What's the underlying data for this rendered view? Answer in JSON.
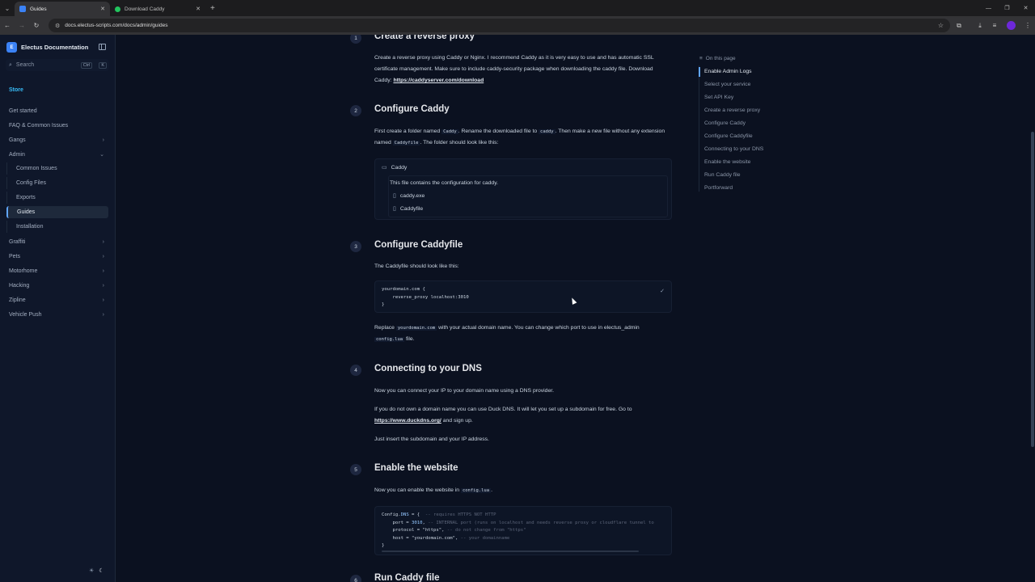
{
  "browser": {
    "tabs": [
      {
        "title": "Guides",
        "active": true
      },
      {
        "title": "Download Caddy",
        "active": false
      }
    ],
    "url": "docs.electus-scripts.com/docs/admin/guides"
  },
  "sidebar": {
    "brand": "Electus Documentation",
    "logo_text": "E",
    "search_placeholder": "Search",
    "search_kbd": [
      "Ctrl",
      "K"
    ],
    "store": "Store",
    "items": [
      {
        "label": "Get started"
      },
      {
        "label": "FAQ & Common Issues"
      },
      {
        "label": "Gangs"
      },
      {
        "label": "Admin"
      },
      {
        "label": "Graffiti"
      },
      {
        "label": "Pets"
      },
      {
        "label": "Motorhome"
      },
      {
        "label": "Hacking"
      },
      {
        "label": "Zipline"
      },
      {
        "label": "Vehicle Push"
      }
    ],
    "admin_children": [
      {
        "label": "Common Issues"
      },
      {
        "label": "Config Files"
      },
      {
        "label": "Exports"
      },
      {
        "label": "Guides"
      },
      {
        "label": "Installation"
      }
    ]
  },
  "content": {
    "s1": {
      "num": "1",
      "title": "Create a reverse proxy",
      "p1": "Create a reverse proxy using Caddy or Nginx. I recommend Caddy as it is very easy to use and has automatic SSL certificate management. Make sure to include caddy-security package when downloading the caddy file. Download Caddy: ",
      "link": "https://caddyserver.com/download"
    },
    "s2": {
      "num": "2",
      "title": "Configure Caddy",
      "p_a": "First create a folder named ",
      "code_a": "Caddy",
      "p_b": ". Rename the downloaded file to ",
      "code_b": "caddy",
      "p_c": ". Then make a new file without any extension named ",
      "code_c": "Caddyfile",
      "p_d": ". The folder should look like this:",
      "folder": "Caddy",
      "folder_desc": "This file contains the configuration for caddy.",
      "files": [
        "caddy.exe",
        "Caddyfile"
      ]
    },
    "s3": {
      "num": "3",
      "title": "Configure Caddyfile",
      "p1": "The Caddyfile should look like this:",
      "code_lines": [
        "yourdomain.com {",
        "    reverse_proxy localhost:3010",
        "}"
      ],
      "p2a": "Replace ",
      "p2code": "yourdomain.com",
      "p2b": " with your actual domain name. You can change which port to use in electus_admin ",
      "p2code2": "config.lua",
      "p2c": " file."
    },
    "s4": {
      "num": "4",
      "title": "Connecting to your DNS",
      "p1": "Now you can connect your IP to your domain name using a DNS provider.",
      "p2a": "If you do not own a domain name you can use Duck DNS. It will let you set up a subdomain for free. Go to ",
      "p2link": "https://www.duckdns.org/",
      "p2b": " and sign up.",
      "p3": "Just insert the subdomain and your IP address."
    },
    "s5": {
      "num": "5",
      "title": "Enable the website",
      "p1a": "Now you can enable the website in ",
      "p1code": "config.lua",
      "p1b": ".",
      "code": {
        "l1a": "Config.",
        "l1b": "DNS",
        "l1c": " = {",
        "l1d": "  -- requires HTTPS NOT HTTP",
        "l2a": "    port = ",
        "l2b": "3010",
        "l2c": ",",
        "l2d": " -- INTERNAL port (runs on localhost and needs reverse proxy or cloudflare tunnel to",
        "l3a": "    protocol = ",
        "l3b": "\"https\"",
        "l3c": ",",
        "l3d": " -- do not change from \"https\"",
        "l4a": "    host = ",
        "l4b": "\"yourdomain.com\"",
        "l4c": ",",
        "l4d": " -- your domainname",
        "l5": "}"
      }
    },
    "s6": {
      "num": "6",
      "title": "Run Caddy file"
    }
  },
  "toc": {
    "title": "On this page",
    "items": [
      "Enable Admin Logs",
      "Select your service",
      "Set API Key",
      "Create a reverse proxy",
      "Configure Caddy",
      "Configure Caddyfile",
      "Connecting to your DNS",
      "Enable the website",
      "Run Caddy file",
      "Portforward"
    ]
  }
}
